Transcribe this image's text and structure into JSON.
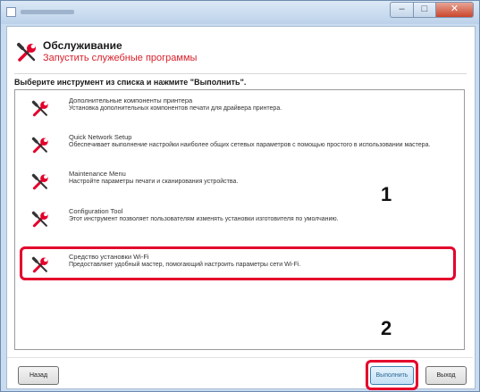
{
  "window": {
    "title_bar": {
      "controls": [
        "minimize",
        "maximize",
        "close"
      ]
    }
  },
  "header": {
    "title": "Обслуживание",
    "subtitle": "Запустить служебные программы",
    "icon": "wrench-screwdriver-icon"
  },
  "instruction": "Выберите инструмент из списка и нажмите \"Выполнить\".",
  "tools": [
    {
      "title": "Дополнительные компоненты принтера",
      "description": "Установка дополнительных компонентов печати для драйвера принтера.",
      "icon": "wrench-screwdriver-icon"
    },
    {
      "title": "Quick Network Setup",
      "description": "Обеспечивает выполнение настройки наиболее общих сетевых параметров с помощью простого в использовании мастера.",
      "icon": "wrench-screwdriver-icon"
    },
    {
      "title": "Maintenance Menu",
      "description": "Настройте параметры печати и сканирования устройства.",
      "icon": "wrench-screwdriver-icon"
    },
    {
      "title": "Configuration Tool",
      "description": "Этот инструмент позволяет пользователям изменять установки изготовителя по умолчанию.",
      "icon": "wrench-screwdriver-icon"
    },
    {
      "title": "Средство установки Wi-Fi",
      "description": "Предоставляет удобный мастер, помогающий настроить параметры сети Wi-Fi.",
      "icon": "wrench-screwdriver-icon"
    }
  ],
  "callouts": {
    "step1": "1",
    "step2": "2"
  },
  "buttons": {
    "back": "Назад",
    "execute": "Выполнить",
    "exit": "Выход"
  },
  "colors": {
    "accent_red": "#e4002b",
    "subtitle_red": "#d8212b",
    "window_frame": "#c9dcef"
  }
}
